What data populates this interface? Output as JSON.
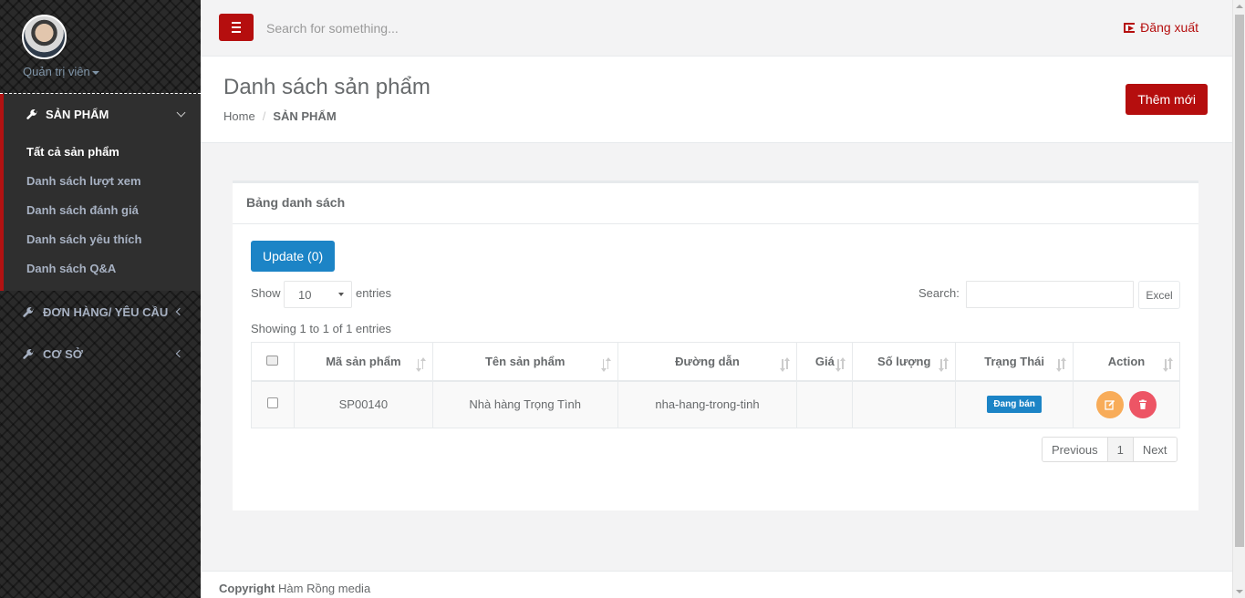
{
  "user": {
    "name": "Quản trị viên"
  },
  "sidebar": {
    "active_section": {
      "label": "SẢN PHẨM",
      "icon": "wrench-icon"
    },
    "submenu": [
      {
        "label": "Tất cả sản phẩm"
      },
      {
        "label": "Danh sách lượt xem"
      },
      {
        "label": "Danh sách đánh giá"
      },
      {
        "label": "Danh sách yêu thích"
      },
      {
        "label": "Danh sách Q&A"
      }
    ],
    "sections": [
      {
        "label": "ĐƠN HÀNG/ YÊU CẦU",
        "icon": "wrench-icon"
      },
      {
        "label": "CƠ SỞ",
        "icon": "wrench-icon"
      }
    ]
  },
  "topbar": {
    "search_placeholder": "Search for something...",
    "logout_label": "Đăng xuất"
  },
  "heading": {
    "title": "Danh sách sản phẩm",
    "breadcrumb_home": "Home",
    "breadcrumb_current": "SẢN PHẨM",
    "add_button": "Thêm mới"
  },
  "panel": {
    "title": "Bảng danh sách",
    "update_button": "Update (0)",
    "show_label": "Show",
    "page_size": "10",
    "entries_label": "entries",
    "search_label": "Search:",
    "excel_button": "Excel",
    "showing_text": "Showing 1 to 1 of 1 entries"
  },
  "table": {
    "columns": [
      "Mã sản phẩm",
      "Tên sản phẩm",
      "Đường dẫn",
      "Giá",
      "Số lượng",
      "Trạng Thái",
      "Action"
    ],
    "rows": [
      {
        "code": "SP00140",
        "name": "Nhà hàng Trọng Tình",
        "slug": "nha-hang-trong-tinh",
        "price": "",
        "qty": "",
        "status": "Đang bán"
      }
    ]
  },
  "pagination": {
    "previous": "Previous",
    "page": "1",
    "next": "Next"
  },
  "footer": {
    "copyright_label": "Copyright",
    "company": "Hàm Rồng media"
  },
  "colors": {
    "accent_red": "#b50e0e",
    "primary_blue": "#1c84c6",
    "edit_orange": "#f8ac59",
    "delete_red": "#ed5565"
  }
}
